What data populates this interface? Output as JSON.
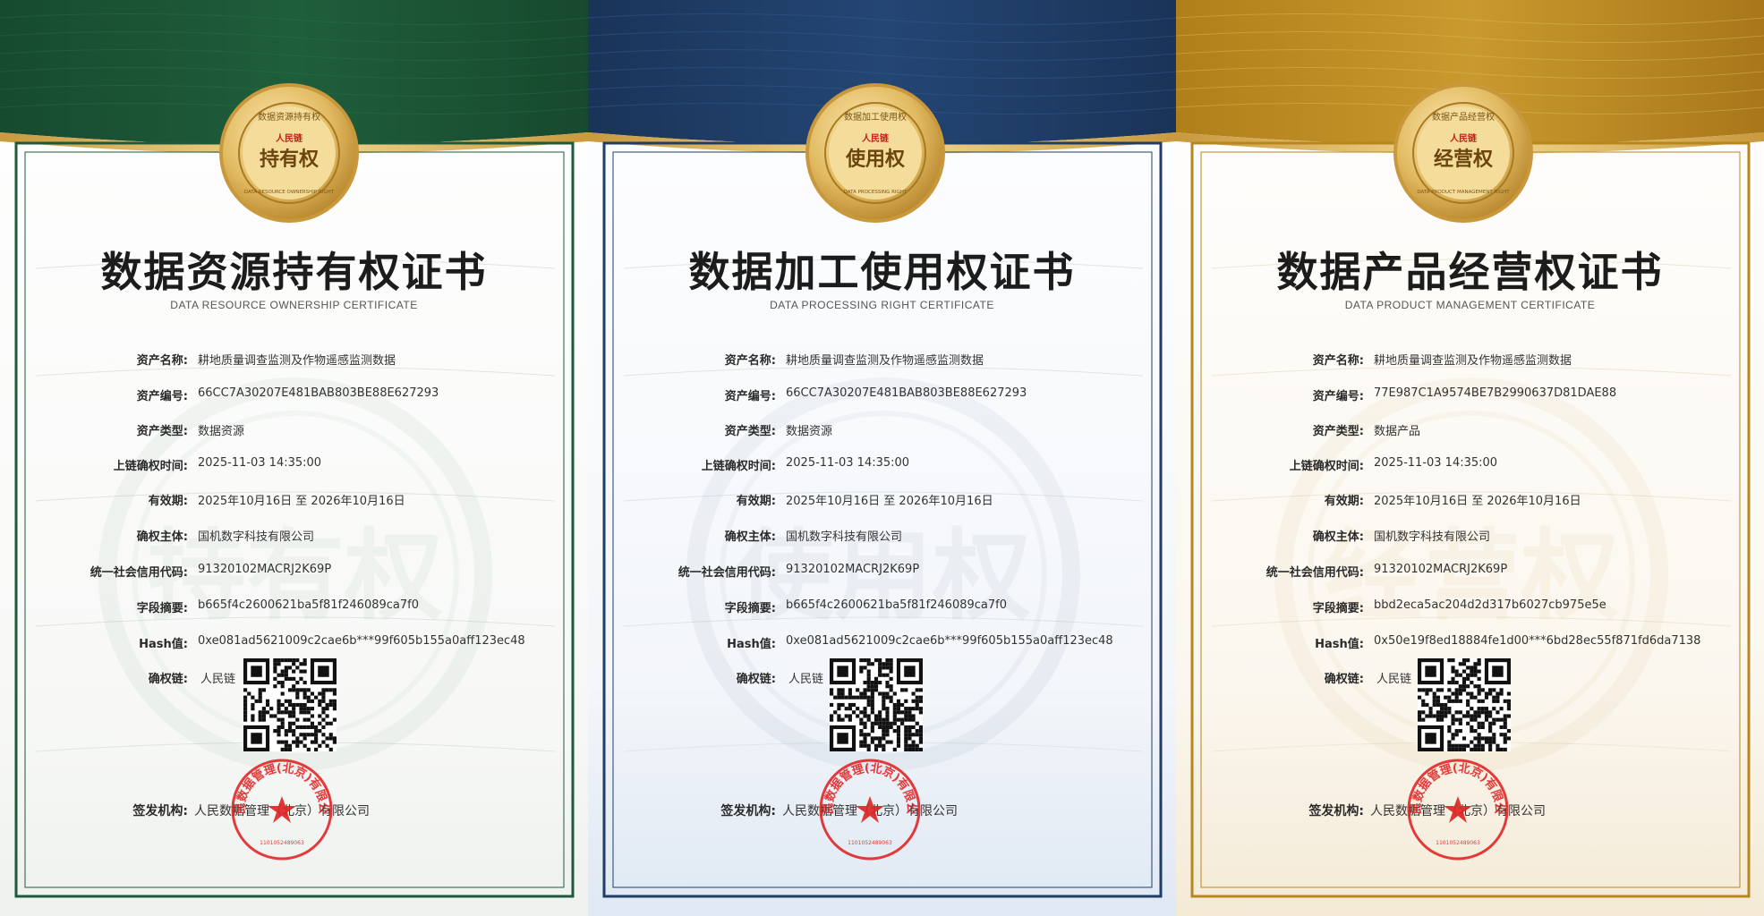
{
  "colors": {
    "green": "#1e5a3a",
    "blue": "#1f3d67",
    "amber": "#b8861e",
    "gold": "#d7b05c",
    "seal_red": "#e02020"
  },
  "certificates": [
    {
      "theme": "green",
      "medal_word": "持有权",
      "medal_ring_text": "数据资源持有权",
      "medal_ring_text_en": "DATA RESOURCE OWNERSHIP RIGHT",
      "medal_logo": "人民链",
      "title": "数据资源持有权证书",
      "subtitle": "DATA RESOURCE OWNERSHIP CERTIFICATE",
      "watermark": "持有权",
      "fields": [
        {
          "label": "资产名称:",
          "value": "耕地质量调查监测及作物遥感监测数据"
        },
        {
          "label": "资产编号:",
          "value": "66CC7A30207E481BAB803BE88E627293"
        },
        {
          "label": "资产类型:",
          "value": "数据资源"
        },
        {
          "label": "上链确权时间:",
          "value": "2025-11-03 14:35:00"
        },
        {
          "label": "有效期:",
          "value": "2025年10月16日 至 2026年10月16日"
        },
        {
          "label": "确权主体:",
          "value": "国机数字科技有限公司"
        },
        {
          "label": "统一社会信用代码:",
          "value": "91320102MACRJ2K69P"
        },
        {
          "label": "字段摘要:",
          "value": "b665f4c2600621ba5f81f246089ca7f0"
        },
        {
          "label": "Hash值:",
          "value": "0xe081ad5621009c2cae6b***99f605b155a0aff123ec48"
        }
      ],
      "chain_label": "确权链:",
      "chain_value": "人民链",
      "issuer_label": "签发机构:",
      "issuer_value": "人民数据管理（北京）有限公司",
      "stamp_text": "人民数据管理(北京)有限公司",
      "stamp_code": "1101052489063"
    },
    {
      "theme": "blue",
      "medal_word": "使用权",
      "medal_ring_text": "数据加工使用权",
      "medal_ring_text_en": "DATA PROCESSING RIGHT",
      "medal_logo": "人民链",
      "title": "数据加工使用权证书",
      "subtitle": "DATA PROCESSING RIGHT CERTIFICATE",
      "watermark": "使用权",
      "fields": [
        {
          "label": "资产名称:",
          "value": "耕地质量调查监测及作物遥感监测数据"
        },
        {
          "label": "资产编号:",
          "value": "66CC7A30207E481BAB803BE88E627293"
        },
        {
          "label": "资产类型:",
          "value": "数据资源"
        },
        {
          "label": "上链确权时间:",
          "value": "2025-11-03 14:35:00"
        },
        {
          "label": "有效期:",
          "value": "2025年10月16日 至 2026年10月16日"
        },
        {
          "label": "确权主体:",
          "value": "国机数字科技有限公司"
        },
        {
          "label": "统一社会信用代码:",
          "value": "91320102MACRJ2K69P"
        },
        {
          "label": "字段摘要:",
          "value": "b665f4c2600621ba5f81f246089ca7f0"
        },
        {
          "label": "Hash值:",
          "value": "0xe081ad5621009c2cae6b***99f605b155a0aff123ec48"
        }
      ],
      "chain_label": "确权链:",
      "chain_value": "人民链",
      "issuer_label": "签发机构:",
      "issuer_value": "人民数据管理（北京）有限公司",
      "stamp_text": "人民数据管理(北京)有限公司",
      "stamp_code": "1101052489063"
    },
    {
      "theme": "amber",
      "medal_word": "经营权",
      "medal_ring_text": "数据产品经营权",
      "medal_ring_text_en": "DATA PRODUCT MANAGEMENT RIGHT",
      "medal_logo": "人民链",
      "title": "数据产品经营权证书",
      "subtitle": "DATA PRODUCT MANAGEMENT CERTIFICATE",
      "watermark": "经营权",
      "fields": [
        {
          "label": "资产名称:",
          "value": "耕地质量调查监测及作物遥感监测数据"
        },
        {
          "label": "资产编号:",
          "value": "77E987C1A9574BE7B2990637D81DAE88"
        },
        {
          "label": "资产类型:",
          "value": "数据产品"
        },
        {
          "label": "上链确权时间:",
          "value": "2025-11-03 14:35:00"
        },
        {
          "label": "有效期:",
          "value": "2025年10月16日 至 2026年10月16日"
        },
        {
          "label": "确权主体:",
          "value": "国机数字科技有限公司"
        },
        {
          "label": "统一社会信用代码:",
          "value": "91320102MACRJ2K69P"
        },
        {
          "label": "字段摘要:",
          "value": "bbd2eca5ac204d2d317b6027cb975e5e"
        },
        {
          "label": "Hash值:",
          "value": "0x50e19f8ed18884fe1d00***6bd28ec55f871fd6da7138"
        }
      ],
      "chain_label": "确权链:",
      "chain_value": "人民链",
      "issuer_label": "签发机构:",
      "issuer_value": "人民数据管理（北京）有限公司",
      "stamp_text": "人民数据管理(北京)有限公司",
      "stamp_code": "1101052489063"
    }
  ]
}
